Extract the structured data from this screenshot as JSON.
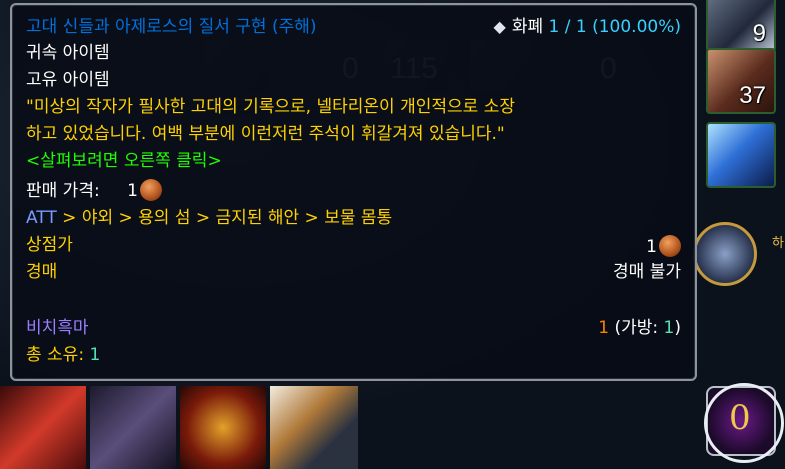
{
  "tooltip": {
    "title": "고대 신들과 아제로스의 질서 구현 (주해)",
    "currency_label": "화폐",
    "currency_value": "1 / 1 (100.00%)",
    "binding": "귀속 아이템",
    "unique": "고유 아이템",
    "flavor_line1": "\"미상의 작자가 필사한 고대의 기록으로, 넬타리온이 개인적으로 소장",
    "flavor_line2": "하고 있었습니다. 여백 부분에 이런저런 주석이 휘갈겨져 있습니다.\"",
    "action_hint": "<살펴보려면 오른쪽 클릭>",
    "sell_price_label": "판매 가격:",
    "sell_price_value": "1",
    "source_prefix": "ATT",
    "source_path": " > 야외 > 용의 섬 > 금지된 해안 > 보물 몸통",
    "vendor_label": "상점가",
    "vendor_value": "1",
    "auction_label": "경매",
    "auction_value": "경매 불가",
    "character_name": "비치흑마",
    "char_count": "1",
    "char_bank_label": "(가방:",
    "char_bank_value": "1",
    "char_bank_close": ")",
    "total_label": "총 소유:",
    "total_value": "1"
  },
  "background": {
    "slot_numbers": [
      "0",
      "115",
      "0"
    ]
  },
  "side_icons": {
    "count_top": "9",
    "count_second": "37",
    "partial_text": "하"
  },
  "colors": {
    "title": "#0070dd",
    "gold": "#ffd100",
    "green": "#1eff00",
    "purple": "#9b7dff",
    "orange": "#ff8000",
    "mint": "#4fe3b7"
  },
  "icons": [
    "diamond-icon",
    "copper-coin-icon",
    "eye-icon"
  ]
}
